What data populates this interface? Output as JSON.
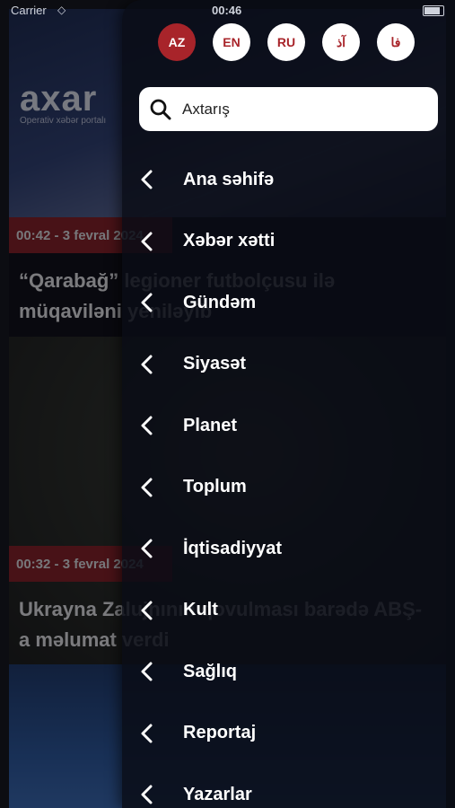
{
  "status_bar": {
    "carrier": "Carrier",
    "time": "00:46"
  },
  "brand": {
    "logo": "axar",
    "tagline": "Operativ xəbər portalı"
  },
  "feed": [
    {
      "date": "00:42 - 3 fevral 2024",
      "headline": "“Qarabağ” legioner futbolçusu ilə müqaviləni yeniləyib"
    },
    {
      "date": "00:32 - 3 fevral 2024",
      "headline": "Ukrayna Zalujnının qovulması barədə ABŞ-a məlumat verdi"
    }
  ],
  "languages": [
    {
      "code": "AZ",
      "active": true
    },
    {
      "code": "EN",
      "active": false
    },
    {
      "code": "RU",
      "active": false
    },
    {
      "code": "آذ",
      "active": false
    },
    {
      "code": "فا",
      "active": false
    }
  ],
  "search": {
    "placeholder": "Axtarış"
  },
  "menu": [
    "Ana səhifə",
    "Xəbər xətti",
    "Gündəm",
    "Siyasət",
    "Planet",
    "Toplum",
    "İqtisadiyyat",
    "Kult",
    "Sağlıq",
    "Reportaj",
    "Yazarlar"
  ],
  "colors": {
    "accent": "#a8242a",
    "drawer_bg": "#0a0c16",
    "date_badge": "#8b1e22"
  }
}
